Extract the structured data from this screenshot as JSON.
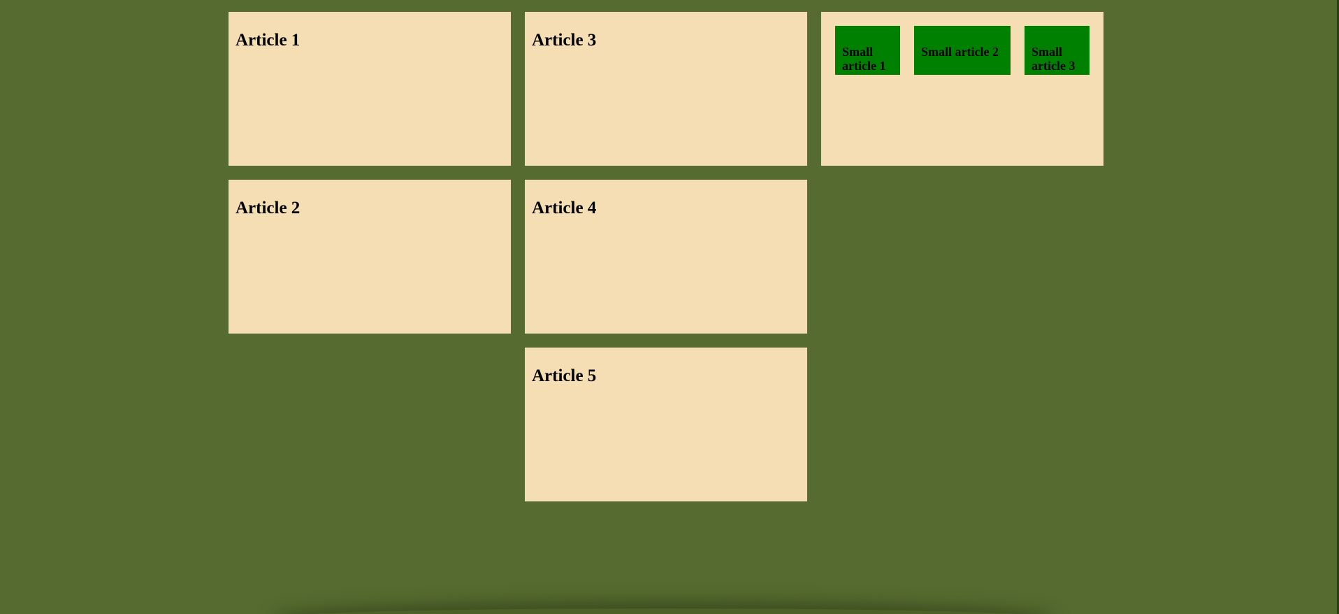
{
  "articles": [
    {
      "title": "Article 1"
    },
    {
      "title": "Article 2"
    },
    {
      "title": "Article 3"
    },
    {
      "title": "Article 4"
    },
    {
      "title": "Article 5"
    }
  ],
  "small_articles": [
    {
      "title": "Small article 1"
    },
    {
      "title": "Small article 2"
    },
    {
      "title": "Small article 3"
    }
  ],
  "colors": {
    "background": "#556b2f",
    "article_bg": "#f5deb3",
    "small_article_bg": "#008000"
  }
}
